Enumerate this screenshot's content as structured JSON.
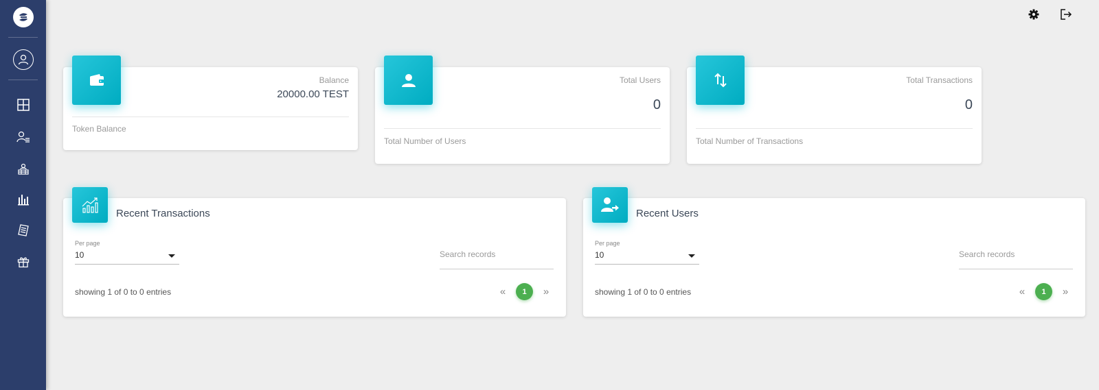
{
  "sidebar": {
    "logo_icon": "brand-logo",
    "avatar_icon": "user-circle-icon",
    "items": [
      {
        "icon": "dashboard-grid-icon"
      },
      {
        "icon": "user-list-icon"
      },
      {
        "icon": "merchant-icon"
      },
      {
        "icon": "bar-chart-icon"
      },
      {
        "icon": "document-icon"
      },
      {
        "icon": "gift-icon"
      }
    ],
    "colors": {
      "background": "#2c3e6b"
    }
  },
  "topbar": {
    "settings_icon": "gear-icon",
    "logout_icon": "logout-icon"
  },
  "stats": {
    "balance": {
      "label": "Balance",
      "value": "20000.00 TEST",
      "footer": "Token Balance",
      "icon": "wallet-icon"
    },
    "users": {
      "label": "Total Users",
      "value": "0",
      "footer": "Total Number of Users",
      "icon": "person-icon"
    },
    "transactions": {
      "label": "Total Transactions",
      "value": "0",
      "footer": "Total Number of Transactions",
      "icon": "swap-vertical-icon"
    }
  },
  "recent_transactions": {
    "title": "Recent Transactions",
    "icon": "trending-chart-icon",
    "per_page_label": "Per page",
    "per_page_value": "10",
    "search_placeholder": "Search records",
    "entries_text": "showing 1 of 0 to 0 entries",
    "pagination": {
      "prev": "«",
      "current": "1",
      "next": "»"
    }
  },
  "recent_users": {
    "title": "Recent Users",
    "icon": "user-arrow-icon",
    "per_page_label": "Per page",
    "per_page_value": "10",
    "search_placeholder": "Search records",
    "entries_text": "showing 1 of 0 to 0 entries",
    "pagination": {
      "prev": "«",
      "current": "1",
      "next": "»"
    }
  },
  "colors": {
    "accent": "#00bcd4",
    "pagination_active": "#4caf50",
    "background": "#eeeeee"
  }
}
